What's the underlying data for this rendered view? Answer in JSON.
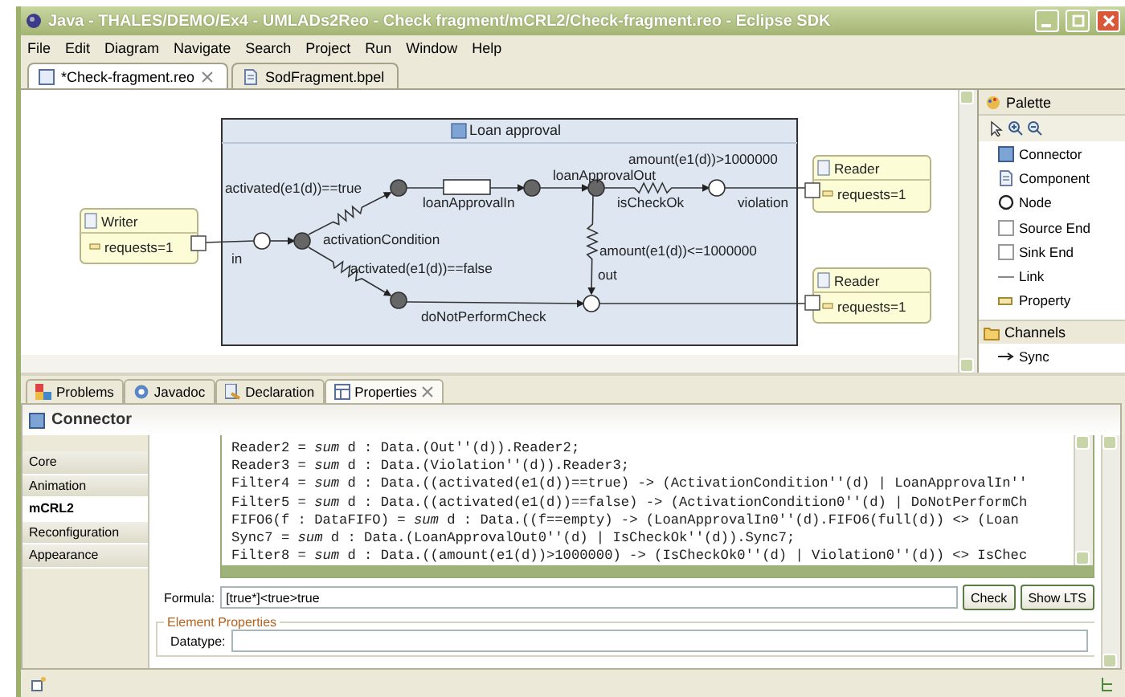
{
  "window": {
    "title": "Java - THALES/DEMO/Ex4 - UMLADs2Reo - Check fragment/mCRL2/Check-fragment.reo - Eclipse SDK"
  },
  "menu": [
    "File",
    "Edit",
    "Diagram",
    "Navigate",
    "Search",
    "Project",
    "Run",
    "Window",
    "Help"
  ],
  "editor_tabs": [
    {
      "label": "*Check-fragment.reo",
      "selected": true
    },
    {
      "label": "SodFragment.bpel",
      "selected": false
    }
  ],
  "diagram": {
    "container_title": "Loan approval",
    "components": [
      {
        "title": "Writer",
        "property": "requests=1"
      },
      {
        "title": "Reader",
        "property": "requests=1"
      },
      {
        "title": "Reader",
        "property": "requests=1"
      }
    ],
    "labels": [
      "amount(e1(d))>1000000",
      "loanApprovalOut",
      "activated(e1(d))==true",
      "loanApprovalIn",
      "isCheckOk",
      "violation",
      "activationCondition",
      "in",
      "amount(e1(d))<=1000000",
      "activated(e1(d))==false",
      "out",
      "doNotPerformCheck"
    ]
  },
  "palette": {
    "title": "Palette",
    "items": [
      "Connector",
      "Component",
      "Node",
      "Source End",
      "Sink End",
      "Link",
      "Property"
    ],
    "drawer": {
      "label": "Channels",
      "items": [
        "Sync"
      ]
    }
  },
  "bottom_tabs": [
    {
      "label": "Problems",
      "selected": false
    },
    {
      "label": "Javadoc",
      "selected": false
    },
    {
      "label": "Declaration",
      "selected": false
    },
    {
      "label": "Properties",
      "selected": true
    }
  ],
  "properties": {
    "title": "Connector",
    "sections": [
      {
        "label": "Core",
        "selected": false
      },
      {
        "label": "Animation",
        "selected": false
      },
      {
        "label": "mCRL2",
        "selected": true
      },
      {
        "label": "Reconfiguration",
        "selected": false
      },
      {
        "label": "Appearance",
        "selected": false
      }
    ],
    "code_lines": [
      "Reader2 = *sum* d : Data.(Out''(d)).Reader2;",
      "Reader3 = *sum* d : Data.(Violation''(d)).Reader3;",
      "Filter4 = *sum* d : Data.((activated(e1(d))==true) -> (ActivationCondition''(d) | LoanApprovalIn''",
      "Filter5 = *sum* d : Data.((activated(e1(d))==false) -> (ActivationCondition0''(d) | DoNotPerformCh",
      "FIFO6(f : DataFIFO) = *sum* d : Data.((f==empty) -> (LoanApprovalIn0''(d).FIFO6(full(d)) <> (Loan",
      "Sync7 = *sum* d : Data.(LoanApprovalOut0''(d) | IsCheckOk''(d)).Sync7;",
      "Filter8 = *sum* d : Data.((amount(e1(d))>1000000) -> (IsCheckOk0''(d) | Violation0''(d)) <> IsChec"
    ],
    "formula": {
      "label": "Formula:",
      "value": "[true*]<true>true"
    },
    "buttons": [
      "Check",
      "Show LTS"
    ],
    "element_properties": {
      "legend": "Element Properties",
      "fields": [
        {
          "label": "Datatype:"
        }
      ]
    }
  }
}
